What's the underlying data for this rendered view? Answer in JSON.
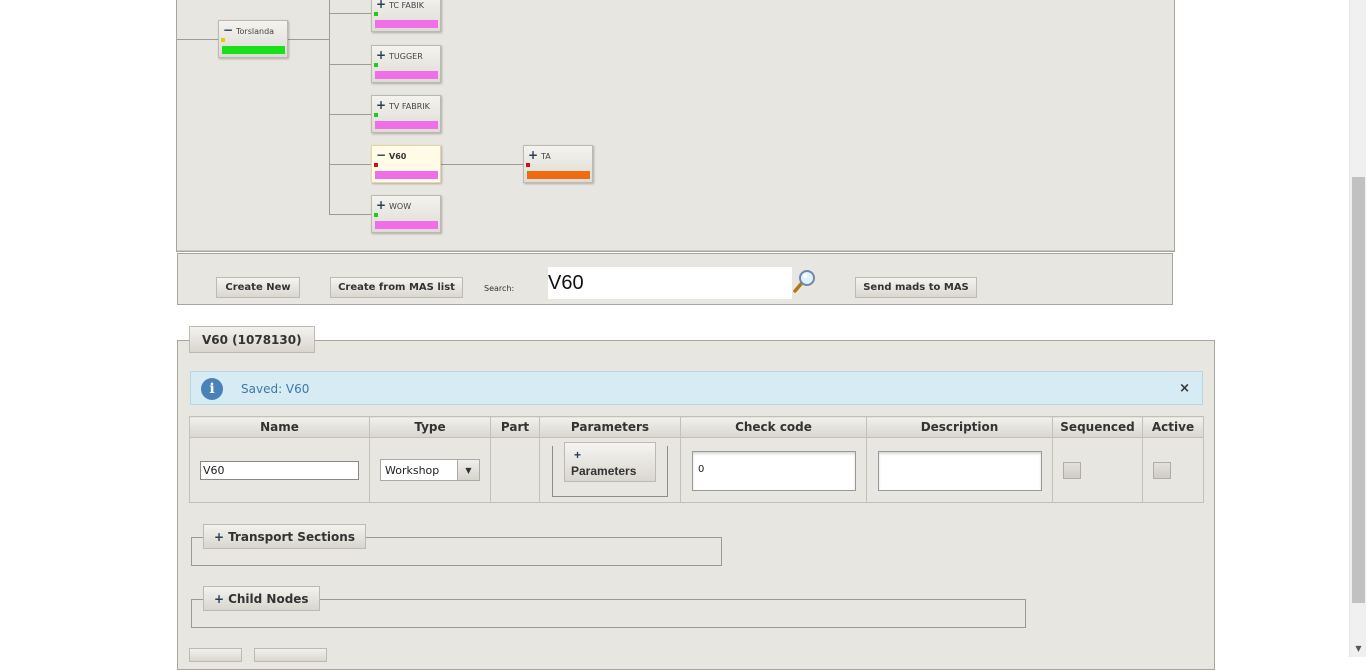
{
  "tree": {
    "root": {
      "label": "Torslanda",
      "sign": "−",
      "bar_color": "#19e019",
      "dot_color": "#e0d000"
    },
    "children": [
      {
        "label": "TC FABIK",
        "sign": "+",
        "bar_color": "#f06ee8",
        "dot_color": "#19d019"
      },
      {
        "label": "TUGGER",
        "sign": "+",
        "bar_color": "#f06ee8",
        "dot_color": "#19d019"
      },
      {
        "label": "TV FABRIK",
        "sign": "+",
        "bar_color": "#f06ee8",
        "dot_color": "#19d019"
      },
      {
        "label": "V60",
        "sign": "−",
        "bar_color": "#f06ee8",
        "dot_color": "#d01010",
        "selected": true
      },
      {
        "label": "WOW",
        "sign": "+",
        "bar_color": "#f06ee8",
        "dot_color": "#19d019"
      }
    ],
    "grandchild": {
      "label": "TA",
      "sign": "+",
      "bar_color": "#f06a10",
      "dot_color": "#d01010"
    }
  },
  "toolbar": {
    "create_new": "Create New",
    "create_from_mas": "Create from MAS list",
    "search_label": "Search:",
    "search_value": "V60",
    "send_mads": "Send mads to MAS"
  },
  "detail": {
    "legend": "V60 (1078130)",
    "info_message": "Saved: V60",
    "info_close": "×",
    "columns": [
      "Name",
      "Type",
      "Part",
      "Parameters",
      "Check code",
      "Description",
      "Sequenced",
      "Active"
    ],
    "row": {
      "name": "V60",
      "type": "Workshop",
      "type_arrow": "▼",
      "part": "",
      "parameters_plus": "+",
      "parameters_label": "Parameters",
      "check_code": "0",
      "description": "",
      "sequenced": false,
      "active": false
    },
    "transport_sections": "Transport Sections",
    "child_nodes": "Child Nodes",
    "plus": "+"
  },
  "colors": {
    "panel_bg": "#e8e6e0",
    "info_bg": "#d6ebf3",
    "info_text": "#3c79a8",
    "sign": "#2b3d57"
  },
  "icons": {
    "search": "magnifier-icon",
    "info": "info-icon",
    "close": "close-icon"
  }
}
